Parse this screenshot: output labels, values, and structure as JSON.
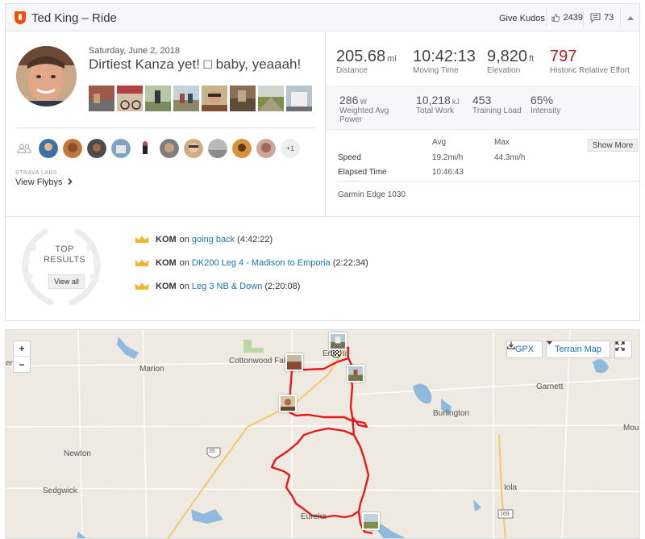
{
  "header": {
    "title": "Ted King – Ride",
    "give_kudos": "Give Kudos",
    "kudos_count": "2439",
    "comments_count": "73"
  },
  "activity": {
    "date": "Saturday, June 2, 2018",
    "title": "Dirtiest Kanza yet! □ baby, yeaaah!",
    "photos_count": 8,
    "plus_athletes": "+1"
  },
  "strava_labs": "STRAVA LABS",
  "flybys": "View Flybys",
  "stats": {
    "distance": {
      "value": "205.68",
      "unit": "mi",
      "label": "Distance"
    },
    "moving_time": {
      "value": "10:42:13",
      "label": "Moving Time"
    },
    "elevation": {
      "value": "9,820",
      "unit": "ft",
      "label": "Elevation"
    },
    "relative_effort": {
      "value": "797",
      "label": "Historic Relative Effort"
    },
    "weighted_power": {
      "value": "286",
      "unit": "W",
      "label": "Weighted Avg Power"
    },
    "total_work": {
      "value": "10,218",
      "unit": "kJ",
      "label": "Total Work"
    },
    "training_load": {
      "value": "453",
      "label": "Training Load"
    },
    "intensity": {
      "value": "65%",
      "label": "Intensity"
    }
  },
  "details": {
    "avg_header": "Avg",
    "max_header": "Max",
    "show_more": "Show More",
    "speed_label": "Speed",
    "speed_avg": "19.2mi/h",
    "speed_max": "44.3mi/h",
    "elapsed_label": "Elapsed Time",
    "elapsed_avg": "10:46:43",
    "device": "Garmin Edge 1030"
  },
  "top_results": {
    "line1": "TOP",
    "line2": "RESULTS",
    "view_all": "View all",
    "items": [
      {
        "badge": "KOM",
        "on": "on",
        "segment": "going back",
        "time": "(4:42:22)"
      },
      {
        "badge": "KOM",
        "on": "on",
        "segment": "DK200 Leg 4 - Madison to Emporia",
        "time": "(2:22:34)"
      },
      {
        "badge": "KOM",
        "on": "on",
        "segment": "Leg 3 NB & Down",
        "time": "(2:20:08)"
      }
    ]
  },
  "map": {
    "zoom_in": "+",
    "zoom_out": "−",
    "gpx": "GPX",
    "terrain": "Terrain Map",
    "towns": {
      "marion": "Marion",
      "cottonwood": "Cottonwood Falls",
      "emporia_a": "Em",
      "emporia_b": "ia",
      "garnett": "Garnett",
      "burlington": "Burlington",
      "newton": "Newton",
      "sedgwick": "Sedgwick",
      "eureka": "Eureka",
      "iola": "Iola",
      "mound": "Moun",
      "left_edge": "er"
    },
    "shields": {
      "i35": "35",
      "us169": "169"
    },
    "colors": {
      "route": "#e8171b",
      "water": "#8fb9de",
      "land": "#eeeae1"
    }
  }
}
